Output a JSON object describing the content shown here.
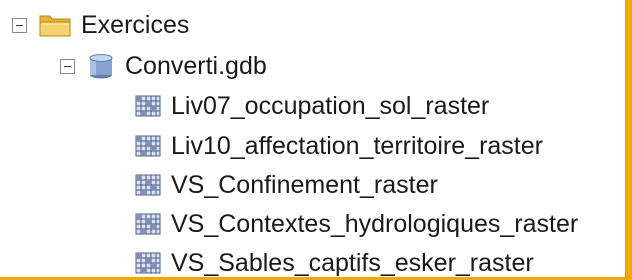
{
  "tree": {
    "root": {
      "label": "Exercices",
      "icon": "folder-icon",
      "expanded": true,
      "children": {
        "gdb": {
          "label": "Converti.gdb",
          "icon": "geodatabase-icon",
          "expanded": true,
          "items": [
            {
              "label": "Liv07_occupation_sol_raster",
              "icon": "raster-dataset-icon"
            },
            {
              "label": "Liv10_affectation_territoire_raster",
              "icon": "raster-dataset-icon"
            },
            {
              "label": "VS_Confinement_raster",
              "icon": "raster-dataset-icon"
            },
            {
              "label": "VS_Contextes_hydrologiques_raster",
              "icon": "raster-dataset-icon"
            },
            {
              "label": "VS_Sables_captifs_esker_raster",
              "icon": "raster-dataset-icon"
            }
          ]
        }
      }
    }
  },
  "colors": {
    "frame": "#f6a700",
    "folder": "#f3c64a",
    "database": "#7d9ac4",
    "raster": "#5a6f99"
  }
}
